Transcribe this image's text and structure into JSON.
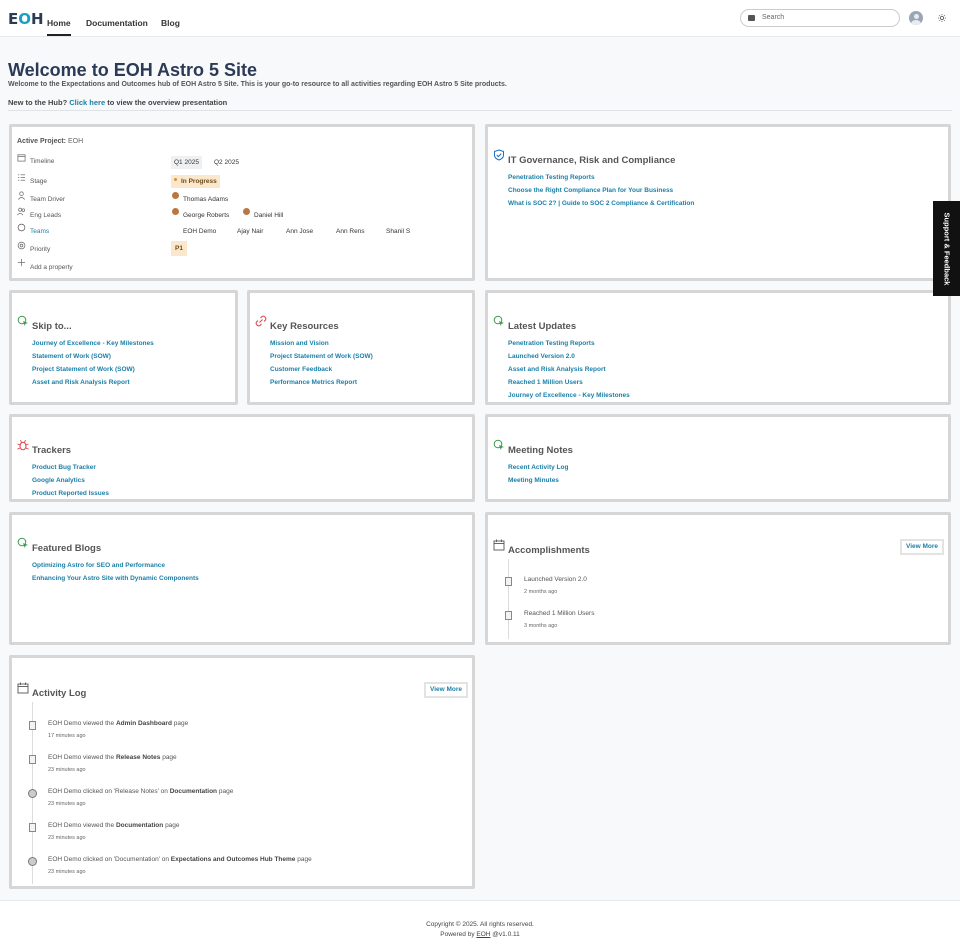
{
  "header": {
    "logo": {
      "e": "E",
      "o": "O",
      "h": "H"
    },
    "nav": [
      "Home",
      "Documentation",
      "Blog"
    ],
    "search_placeholder": "Search"
  },
  "hero": {
    "title": "Welcome to EOH Astro 5 Site",
    "subtitle": "Welcome to the Expectations and Outcomes hub of EOH Astro 5 Site. This is your go-to resource to all activities regarding EOH Astro 5 Site products.",
    "new_prefix": "New to the Hub?",
    "new_link": "Click here",
    "new_suffix": "to view the overview presentation"
  },
  "project": {
    "active_label": "Active Project:",
    "active_value": "EOH",
    "rows": {
      "timeline": "Timeline",
      "stage": "Stage",
      "team_driver": "Team Driver",
      "eng_leads": "Eng Leads",
      "teams": "Teams",
      "priority": "Priority",
      "add_property": "Add a property"
    },
    "timeline_values": [
      "Q1 2025",
      "Q2 2025"
    ],
    "stage_value": "In Progress",
    "team_driver_value": "Thomas Adams",
    "eng_leads_values": [
      "George Roberts",
      "Daniel Hill"
    ],
    "teams_values": [
      "EOH Demo",
      "Ajay Nair",
      "Ann Jose",
      "Ann Rens",
      "Shanil S"
    ],
    "priority_value": "P1"
  },
  "governance": {
    "title": "IT Governance, Risk and Compliance",
    "links": [
      "Penetration Testing Reports",
      "Choose the Right Compliance Plan for Your Business",
      "What is SOC 2? | Guide to SOC 2 Compliance & Certification"
    ]
  },
  "skip": {
    "title": "Skip to...",
    "links": [
      "Journey of Excellence - Key Milestones",
      "Statement of Work (SOW)",
      "Project Statement of Work (SOW)",
      "Asset and Risk Analysis Report"
    ]
  },
  "resources": {
    "title": "Key Resources",
    "links": [
      "Mission and Vision",
      "Project Statement of Work (SOW)",
      "Customer Feedback",
      "Performance Metrics Report"
    ]
  },
  "updates": {
    "title": "Latest Updates",
    "links": [
      "Penetration Testing Reports",
      "Launched Version 2.0",
      "Asset and Risk Analysis Report",
      "Reached 1 Million Users",
      "Journey of Excellence - Key Milestones"
    ]
  },
  "trackers": {
    "title": "Trackers",
    "links": [
      "Product Bug Tracker",
      "Google Analytics",
      "Product Reported Issues"
    ]
  },
  "meetings": {
    "title": "Meeting Notes",
    "links": [
      "Recent Activity Log",
      "Meeting Minutes"
    ]
  },
  "blogs": {
    "title": "Featured Blogs",
    "links": [
      "Optimizing Astro for SEO and Performance",
      "Enhancing Your Astro Site with Dynamic Components"
    ]
  },
  "accomplishments": {
    "title": "Accomplishments",
    "view_more": "View More",
    "items": [
      {
        "text": "Launched Version 2.0",
        "time": "2 months ago"
      },
      {
        "text": "Reached 1 Million Users",
        "time": "3 months ago"
      }
    ]
  },
  "activity": {
    "title": "Activity Log",
    "view_more": "View More",
    "items": [
      {
        "pre": "EOH Demo viewed the",
        "bold": "Admin Dashboard",
        "post": "page",
        "time": "17 minutes ago",
        "icon": "document-icon"
      },
      {
        "pre": "EOH Demo viewed the",
        "bold": "Release Notes",
        "post": "page",
        "time": "23 minutes ago",
        "icon": "document-icon"
      },
      {
        "pre": "EOH Demo clicked on 'Release Notes' on",
        "bold": "Documentation",
        "post": "page",
        "time": "23 minutes ago",
        "icon": "click-icon"
      },
      {
        "pre": "EOH Demo viewed the",
        "bold": "Documentation",
        "post": "page",
        "time": "23 minutes ago",
        "icon": "document-icon"
      },
      {
        "pre": "EOH Demo clicked on 'Documentation' on",
        "bold": "Expectations and Outcomes Hub Theme",
        "post": "page",
        "time": "23 minutes ago",
        "icon": "click-icon"
      }
    ]
  },
  "support": "Support & Feedback",
  "footer": {
    "copyright": "Copyright © 2025. All rights reserved.",
    "powered_prefix": "Powered by",
    "powered_link": "EOH",
    "version": "@v1.0.11"
  },
  "colors": {
    "link": "#1a7fa8",
    "title": "#2b3a55",
    "chip_orange": "#fbe8cc"
  }
}
